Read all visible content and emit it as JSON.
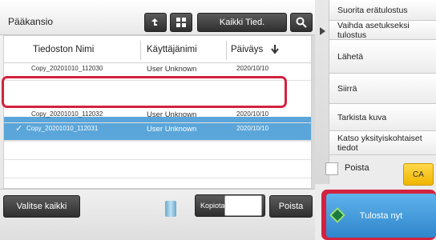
{
  "header": {
    "folder_title": "Pääkansio",
    "all_files_label": "Kaikki Tied."
  },
  "columns": {
    "name": "Tiedoston Nimi",
    "user": "Käyttäjänimi",
    "date": "Päiväys"
  },
  "rows": [
    {
      "name": "Copy_20201010_112030",
      "user": "User Unknown",
      "date": "2020/10/10"
    },
    {
      "name": "Copy_20201010_112031",
      "user": "User Unknown",
      "date": "2020/10/10"
    },
    {
      "name": "Copy_20201010_112032",
      "user": "User Unknown",
      "date": "2020/10/10"
    }
  ],
  "bottom": {
    "select_all": "Valitse kaikki",
    "copies_label": "Kopiota",
    "delete": "Poista"
  },
  "side_menu": {
    "items": [
      "Suorita erätulostus",
      "Vaihda asetukseksi tulostus",
      "Lähetä",
      "Siirrä",
      "Tarkista kuva",
      "Katso yksityiskohtaiset tiedot"
    ],
    "checkbox_label": "Poista",
    "ca_label": "CA",
    "start_label": "Tulosta nyt"
  },
  "colors": {
    "selected_row": "#5aa5d9",
    "highlight_frame": "#d3223f",
    "start_button": "#2f86cc",
    "ca_button": "#f0b500"
  }
}
